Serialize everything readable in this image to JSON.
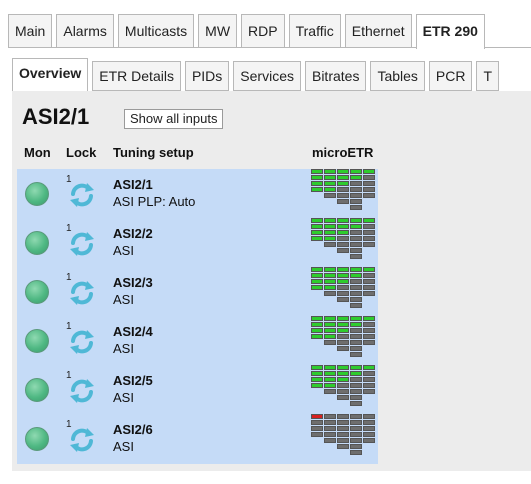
{
  "tabs": [
    "Main",
    "Alarms",
    "Multicasts",
    "MW",
    "RDP",
    "Traffic",
    "Ethernet",
    "ETR 290"
  ],
  "active_tab": "ETR 290",
  "subtabs": [
    "Overview",
    "ETR Details",
    "PIDs",
    "Services",
    "Bitrates",
    "Tables",
    "PCR",
    "T"
  ],
  "active_subtab": "Overview",
  "page_title": "ASI2/1",
  "show_all_button": "Show all inputs",
  "columns": {
    "mon": "Mon",
    "lock": "Lock",
    "tuning": "Tuning setup",
    "micro": "microETR"
  },
  "colors": {
    "ok": "#2ecc2e",
    "grey": "#6e6e6e",
    "error": "#d62020",
    "row_bg": "#c5dbf7"
  },
  "rows": [
    {
      "lock_count": "1",
      "name": "ASI2/1",
      "sub": "ASI PLP: Auto",
      "meter": {
        "green": [
          4,
          4,
          3,
          2,
          1
        ],
        "red": [
          0,
          0,
          0,
          0,
          0
        ]
      }
    },
    {
      "lock_count": "1",
      "name": "ASI2/2",
      "sub": "ASI",
      "meter": {
        "green": [
          4,
          4,
          3,
          2,
          1
        ],
        "red": [
          0,
          0,
          0,
          0,
          0
        ]
      }
    },
    {
      "lock_count": "1",
      "name": "ASI2/3",
      "sub": "ASI",
      "meter": {
        "green": [
          4,
          4,
          3,
          2,
          1
        ],
        "red": [
          0,
          0,
          0,
          0,
          0
        ]
      }
    },
    {
      "lock_count": "1",
      "name": "ASI2/4",
      "sub": "ASI",
      "meter": {
        "green": [
          4,
          4,
          3,
          2,
          1
        ],
        "red": [
          0,
          0,
          0,
          0,
          0
        ]
      }
    },
    {
      "lock_count": "1",
      "name": "ASI2/5",
      "sub": "ASI",
      "meter": {
        "green": [
          4,
          4,
          3,
          2,
          1
        ],
        "red": [
          0,
          0,
          0,
          0,
          0
        ]
      }
    },
    {
      "lock_count": "1",
      "name": "ASI2/6",
      "sub": "ASI",
      "meter": {
        "green": [
          0,
          0,
          0,
          0,
          0
        ],
        "red": [
          1,
          0,
          0,
          0,
          0
        ]
      }
    }
  ]
}
